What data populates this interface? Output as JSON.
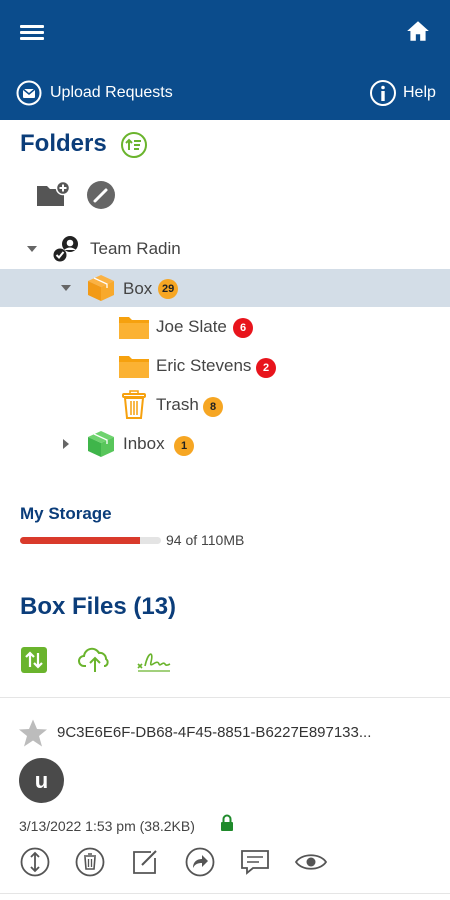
{
  "header": {
    "menu_icon": "hamburger-icon",
    "home_icon": "home-icon",
    "upload_requests_label": "Upload Requests",
    "help_label": "Help",
    "color": "#0b4c8c"
  },
  "folders": {
    "title": "Folders",
    "tree": [
      {
        "label": "Team Radin",
        "icon": "team-icon",
        "expanded": true,
        "badge": ""
      },
      {
        "label": "Box",
        "icon": "box-icon",
        "expanded": true,
        "selected": true,
        "badge": "29"
      },
      {
        "label": "Joe Slate",
        "icon": "folder-icon",
        "badge": "6"
      },
      {
        "label": "Eric Stevens",
        "icon": "folder-icon",
        "badge": "2"
      },
      {
        "label": "Trash",
        "icon": "trash-icon",
        "badge": "8"
      },
      {
        "label": "Inbox",
        "icon": "inbox-box-icon",
        "expanded": false,
        "badge": "1"
      }
    ]
  },
  "storage": {
    "title": "My Storage",
    "used_text": "94 of 110MB",
    "fraction_used": 0.85
  },
  "box_files": {
    "title": "Box Files (13)",
    "files": [
      {
        "name": "9C3E6E6F-DB68-4F45-8851-B6227E897133...",
        "avatar_letter": "u",
        "meta": "3/13/2022 1:53 pm (38.2KB)"
      }
    ]
  },
  "colors": {
    "accent_green": "#6ab42d",
    "badge_orange": "#f6a623",
    "badge_red": "#e8141c",
    "title_blue": "#0b3d7a"
  }
}
